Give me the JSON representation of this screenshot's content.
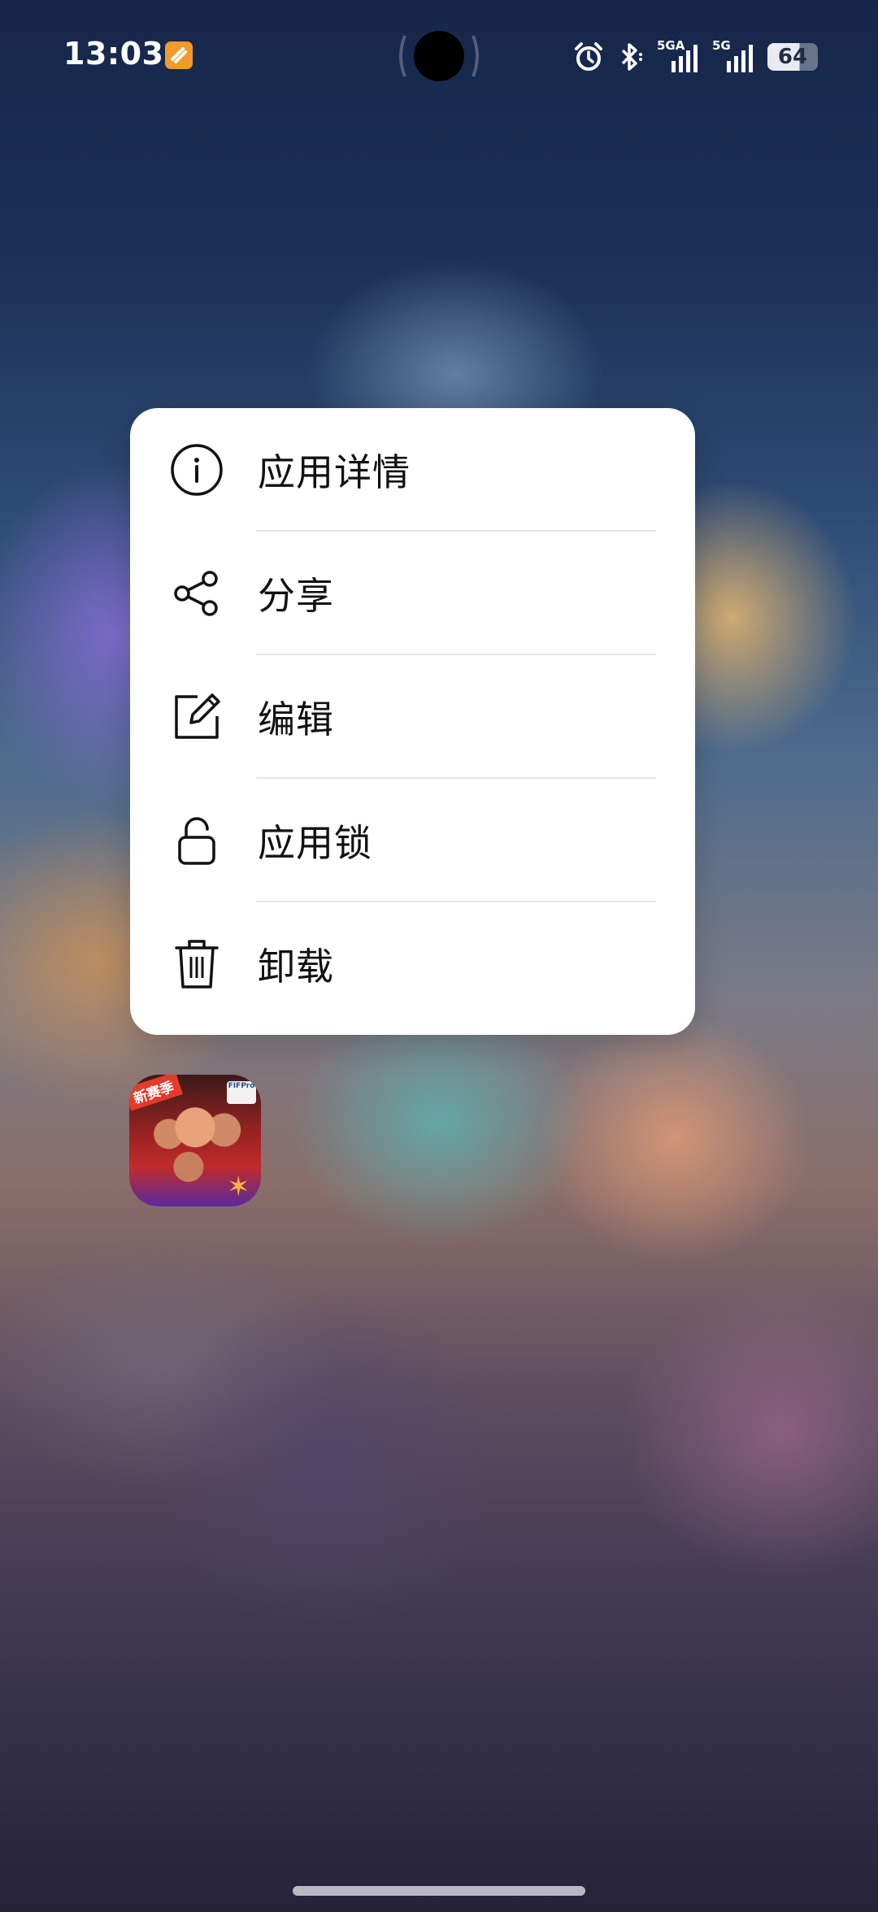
{
  "status_bar": {
    "time": "13:03",
    "notification_icon": "orange-app-notification-icon",
    "alarm_icon": "alarm-clock-icon",
    "bluetooth_icon": "bluetooth-icon",
    "signal1_label": "5GA",
    "signal2_label": "5G",
    "battery_level": "64",
    "battery_fraction": 0.64
  },
  "context_menu": {
    "items": [
      {
        "label": "应用详情",
        "icon": "info-icon"
      },
      {
        "label": "分享",
        "icon": "share-icon"
      },
      {
        "label": "编辑",
        "icon": "edit-icon"
      },
      {
        "label": "应用锁",
        "icon": "lock-icon"
      },
      {
        "label": "卸载",
        "icon": "trash-icon"
      }
    ]
  },
  "app_icon": {
    "badge": "新赛季",
    "tag": "FIFPro"
  },
  "colors": {
    "menu_background": "#ffffff",
    "menu_text": "#111111",
    "notification_orange": "#f19a2c"
  }
}
